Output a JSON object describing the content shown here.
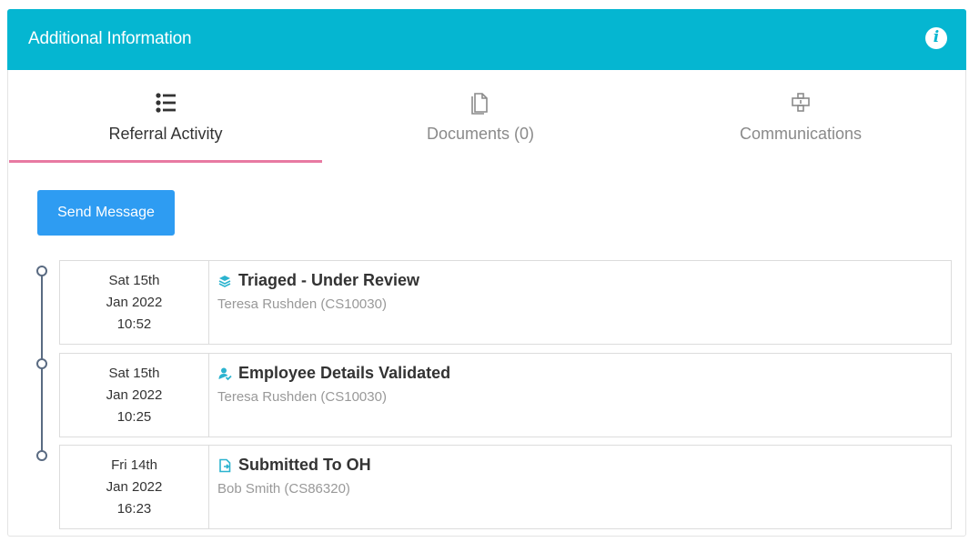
{
  "panel": {
    "title": "Additional Information",
    "info_icon": "info-circle-icon"
  },
  "tabs": [
    {
      "label": "Referral Activity",
      "icon": "list-icon",
      "active": true
    },
    {
      "label": "Documents (0)",
      "icon": "document-icon",
      "active": false
    },
    {
      "label": "Communications",
      "icon": "communications-icon",
      "active": false
    }
  ],
  "actions": {
    "send_message_label": "Send Message"
  },
  "activities": [
    {
      "day": "Sat 15th",
      "month_year": "Jan 2022",
      "time": "10:52",
      "title": "Triaged - Under Review",
      "user": "Teresa Rushden (CS10030)",
      "icon": "layers-icon"
    },
    {
      "day": "Sat 15th",
      "month_year": "Jan 2022",
      "time": "10:25",
      "title": "Employee Details Validated",
      "user": "Teresa Rushden (CS10030)",
      "icon": "user-check-icon"
    },
    {
      "day": "Fri 14th",
      "month_year": "Jan 2022",
      "time": "16:23",
      "title": "Submitted To OH",
      "user": "Bob Smith (CS86320)",
      "icon": "file-submit-icon"
    }
  ],
  "colors": {
    "header": "#05b6d1",
    "active_tab_underline": "#e87aa2",
    "button": "#2e9cf2",
    "timeline": "#5a6b82",
    "activity_icon": "#2bb3cf"
  }
}
